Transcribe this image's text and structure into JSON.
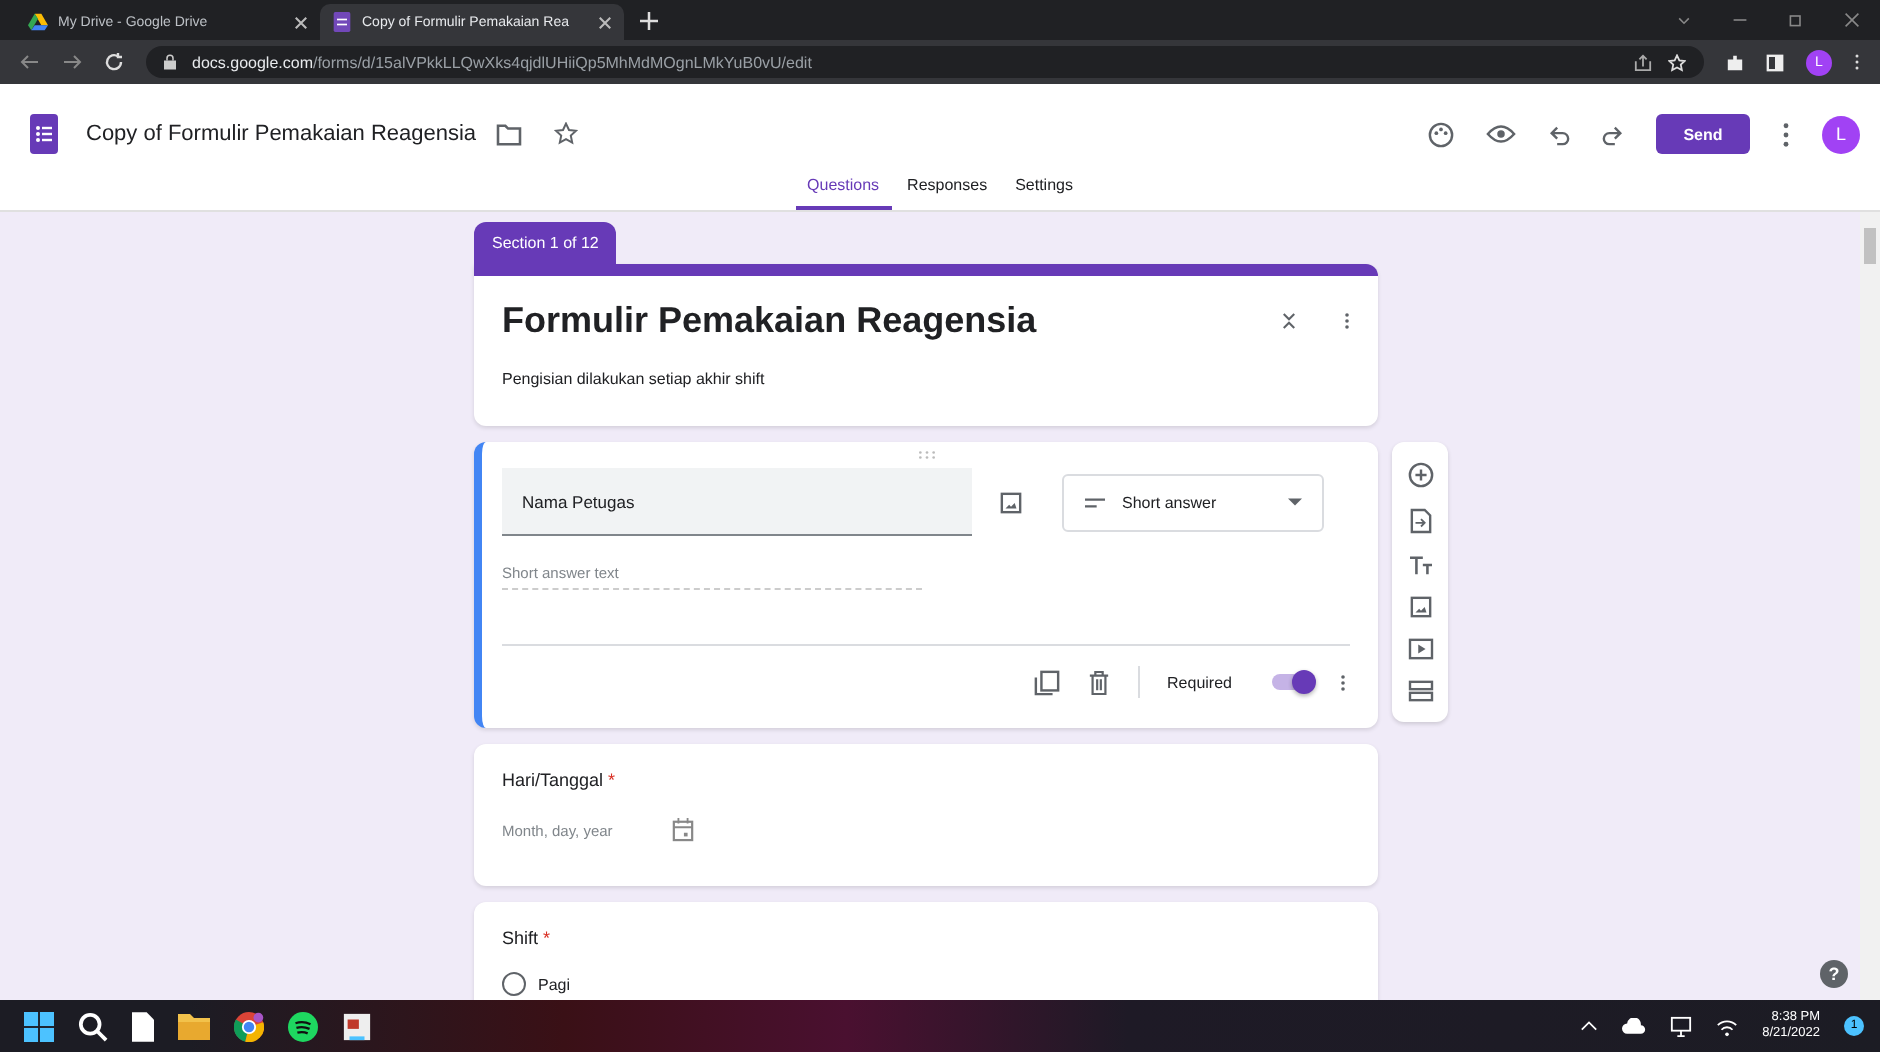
{
  "browser": {
    "tabs": [
      {
        "title": "My Drive - Google Drive",
        "selected": false
      },
      {
        "title": "Copy of Formulir Pemakaian Rea",
        "selected": true
      }
    ],
    "url_host": "docs.google.com",
    "url_path": "/forms/d/15alVPkkLLQwXks4qjdlUHiiQp5MhMdMOgnLMkYuB0vU/edit",
    "profile_initial": "L"
  },
  "header": {
    "doc_title": "Copy of Formulir Pemakaian Reagensia",
    "send": "Send",
    "avatar_initial": "L",
    "tabs": [
      {
        "label": "Questions",
        "selected": true
      },
      {
        "label": "Responses",
        "selected": false
      },
      {
        "label": "Settings",
        "selected": false
      }
    ]
  },
  "section_label": "Section 1 of 12",
  "form": {
    "title": "Formulir Pemakaian Reagensia",
    "description": "Pengisian dilakukan setiap akhir shift"
  },
  "questions": [
    {
      "kind": "short",
      "title": "Nama Petugas",
      "active": true,
      "type_label": "Short answer",
      "placeholder": "Short answer text",
      "required_label": "Required",
      "required": true
    },
    {
      "kind": "date",
      "title": "Hari/Tanggal",
      "active": false,
      "required": true,
      "required_mark": "*",
      "placeholder": "Month, day, year"
    },
    {
      "kind": "choice",
      "title": "Shift",
      "active": false,
      "required": true,
      "required_mark": "*",
      "options": [
        {
          "label": "Pagi",
          "selected": false
        }
      ]
    }
  ],
  "help": "?",
  "taskbar": {
    "time": "8:38 PM",
    "date": "8/21/2022",
    "notifications": "1"
  }
}
